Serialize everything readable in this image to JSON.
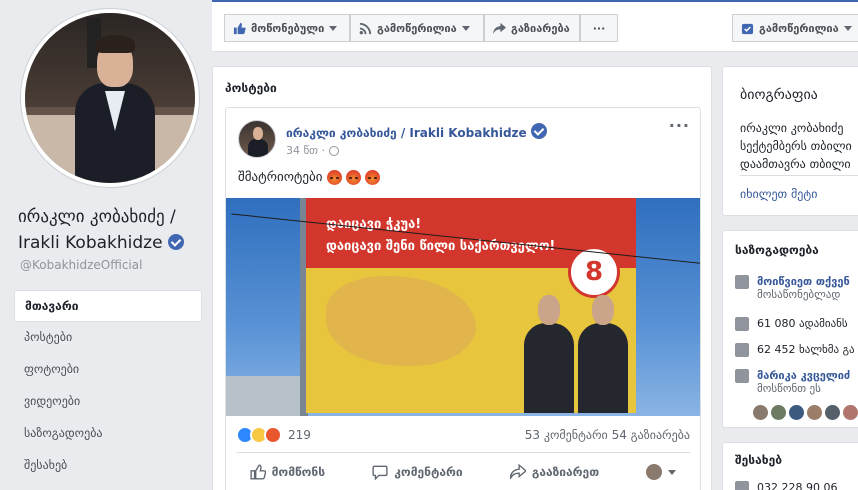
{
  "profile": {
    "name": "ირაკლი კობახიძე / Irakli Kobakhidze",
    "handle": "@KobakhidzeOfficial"
  },
  "nav": {
    "items": [
      {
        "label": "მთავარი",
        "active": true
      },
      {
        "label": "პოსტები"
      },
      {
        "label": "ფოტოები"
      },
      {
        "label": "ვიდეოები"
      },
      {
        "label": "საზოგადოება"
      },
      {
        "label": "შესახებ"
      }
    ]
  },
  "toolbar": {
    "like_label": "მოწონებული",
    "follow_label": "გამოწერილია",
    "share_label": "გაზიარება",
    "more_label": "···",
    "subscribed_label": "გამოწერილია"
  },
  "posts_section": {
    "title": "პოსტები"
  },
  "post": {
    "author": "ირაკლი კობახიძე / Irakli Kobakhidze",
    "time": "34 წთ ·",
    "text": "შმატრიოტები",
    "billboard": {
      "line1": "დაიცავი ჭკუა!",
      "line2": "დაიცავი შენი წილი საქართველო!",
      "number": "8"
    },
    "reaction_count": "219",
    "comments": "53 კომენტარი",
    "shares": "54 გაზიარება",
    "actions": {
      "like": "მომწონს",
      "comment": "კომენტარი",
      "share": "გააზიარეთ"
    }
  },
  "about": {
    "title": "ბიოგრაფია",
    "lines": [
      "ირაკლი კობახიძე",
      "სექტემბერს თბილი",
      "დაამთავრა თბილი"
    ],
    "see_more": "იხილეთ მეტი"
  },
  "community": {
    "title": "საზოგადოება",
    "invite": "მოიწვიეთ თქვენ",
    "invite_sub": "მოსაწონებლად",
    "likes": "61 080 ადამიანს",
    "follows": "62 452 ხალხმა გა",
    "friend": "მარიკა კვცელიძ",
    "friend_sub": "მოსწონთ ეს"
  },
  "info": {
    "title": "შესახებ",
    "phone": "032 228 90 06"
  }
}
